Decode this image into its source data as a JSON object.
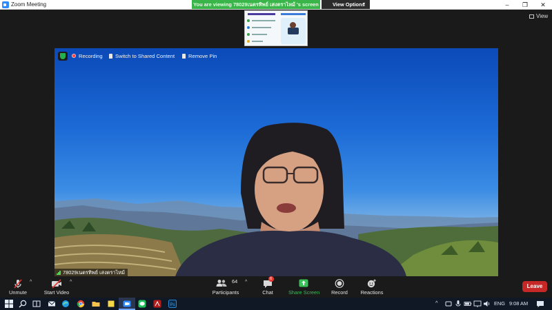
{
  "window": {
    "title": "Zoom Meeting",
    "minimize": "–",
    "restore": "❐",
    "close": "✕"
  },
  "share": {
    "banner": "You are viewing 78029เนตรทิพย์ เสงตราไหม้ 's screen",
    "view_options": "View Options",
    "view_options_caret": "▾"
  },
  "view_button": "View",
  "overlay": {
    "recording": "Recording",
    "switch_shared": "Switch to Shared Content",
    "remove_pin": "Remove Pin"
  },
  "participant_name": "78029เนตรทิพย์ เสงตราไหม้",
  "toolbar": {
    "unmute": "Unmute",
    "start_video": "Start Video",
    "participants": "Participants",
    "participants_count": "64",
    "chat": "Chat",
    "chat_badge": "6",
    "share_screen": "Share Screen",
    "record": "Record",
    "reactions": "Reactions",
    "leave": "Leave",
    "caret": "^"
  },
  "taskbar": {
    "language": "ENG",
    "time": "9:08 AM"
  },
  "colors": {
    "share_banner": "#39b54a",
    "leave": "#c62828",
    "accent": "#2d8cff"
  }
}
